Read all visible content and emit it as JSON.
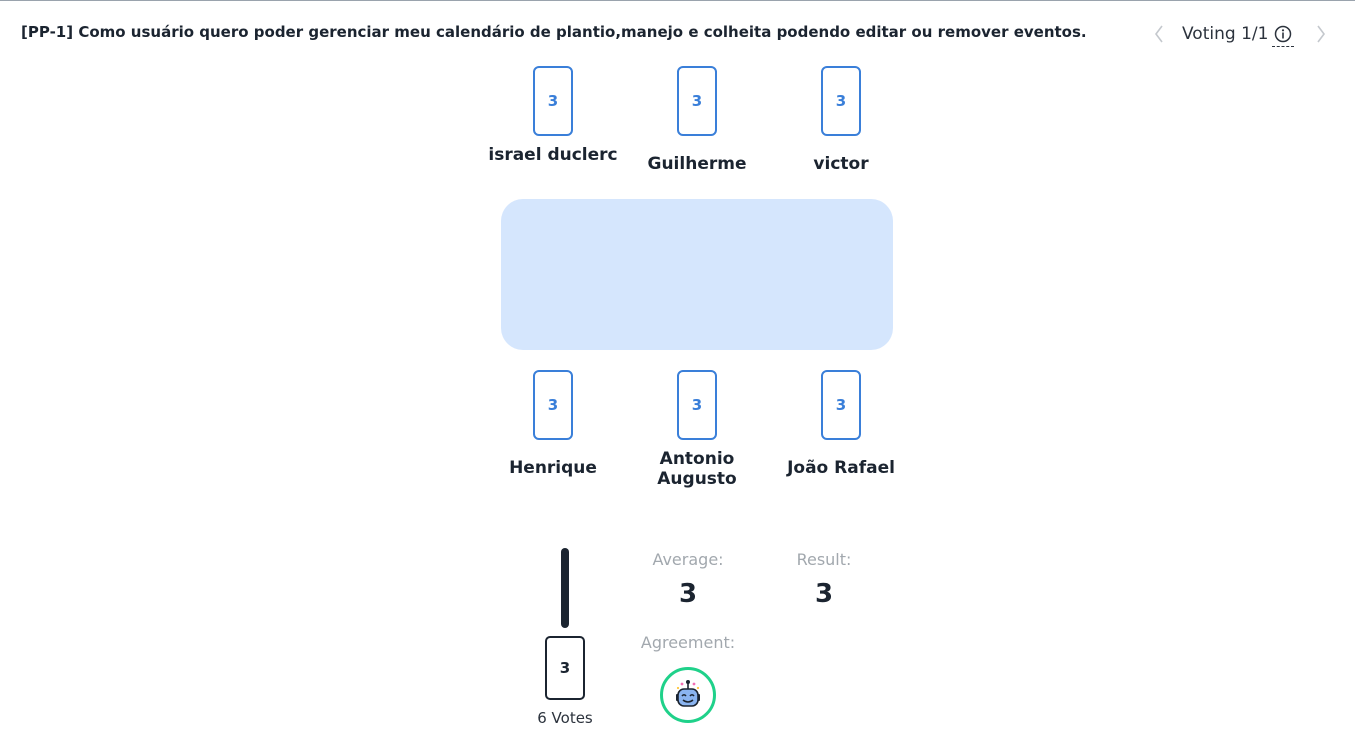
{
  "story": {
    "title": "[PP-1] Como usuário quero poder gerenciar meu calendário de plantio,manejo e colheita podendo editar ou remover eventos."
  },
  "voting": {
    "label": "Voting 1/1",
    "prev_icon": "chevron-left-icon",
    "next_icon": "chevron-right-icon",
    "info_icon": "info-icon"
  },
  "players": [
    {
      "name": "israel duclerc",
      "card": "3"
    },
    {
      "name": "Guilherme",
      "card": "3"
    },
    {
      "name": "victor",
      "card": "3"
    },
    {
      "name": "Henrique",
      "card": "3"
    },
    {
      "name": "Antonio Augusto",
      "card": "3"
    },
    {
      "name": "João Rafael",
      "card": "3"
    }
  ],
  "results": {
    "vote_card": "3",
    "votes_label": "6 Votes",
    "average_label": "Average:",
    "average_value": "3",
    "result_label": "Result:",
    "result_value": "3",
    "agreement_label": "Agreement:",
    "agreement_icon": "happy-robot-icon",
    "agreement_color": "#1fd18a"
  },
  "colors": {
    "card_border": "#3a7fd9",
    "table": "#d5e6fd",
    "text": "#1b2430"
  }
}
